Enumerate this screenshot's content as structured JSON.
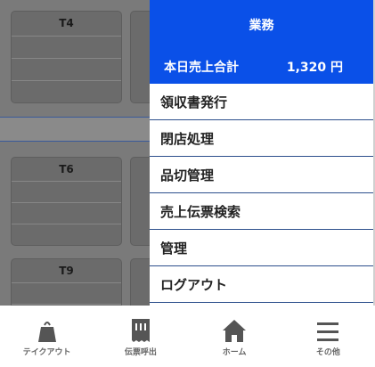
{
  "tables": [
    {
      "label": "T4"
    },
    {
      "label": "T6"
    },
    {
      "label": "T9"
    }
  ],
  "menu": {
    "title": "業務",
    "total_label": "本日売上合計",
    "total_value": "1,320 円",
    "items": [
      {
        "label": "領収書発行"
      },
      {
        "label": "閉店処理"
      },
      {
        "label": "品切管理"
      },
      {
        "label": "売上伝票検索"
      },
      {
        "label": "管理"
      },
      {
        "label": "ログアウト"
      }
    ]
  },
  "nav": {
    "items": [
      {
        "label": "テイクアウト",
        "icon": "takeout-bag-icon"
      },
      {
        "label": "伝票呼出",
        "icon": "receipt-icon"
      },
      {
        "label": "ホーム",
        "icon": "home-icon"
      },
      {
        "label": "その他",
        "icon": "menu-icon"
      }
    ]
  },
  "colors": {
    "menu_header": "#0a50e8",
    "divider": "#2c4f8c",
    "overlay": "#7a7a7a"
  }
}
